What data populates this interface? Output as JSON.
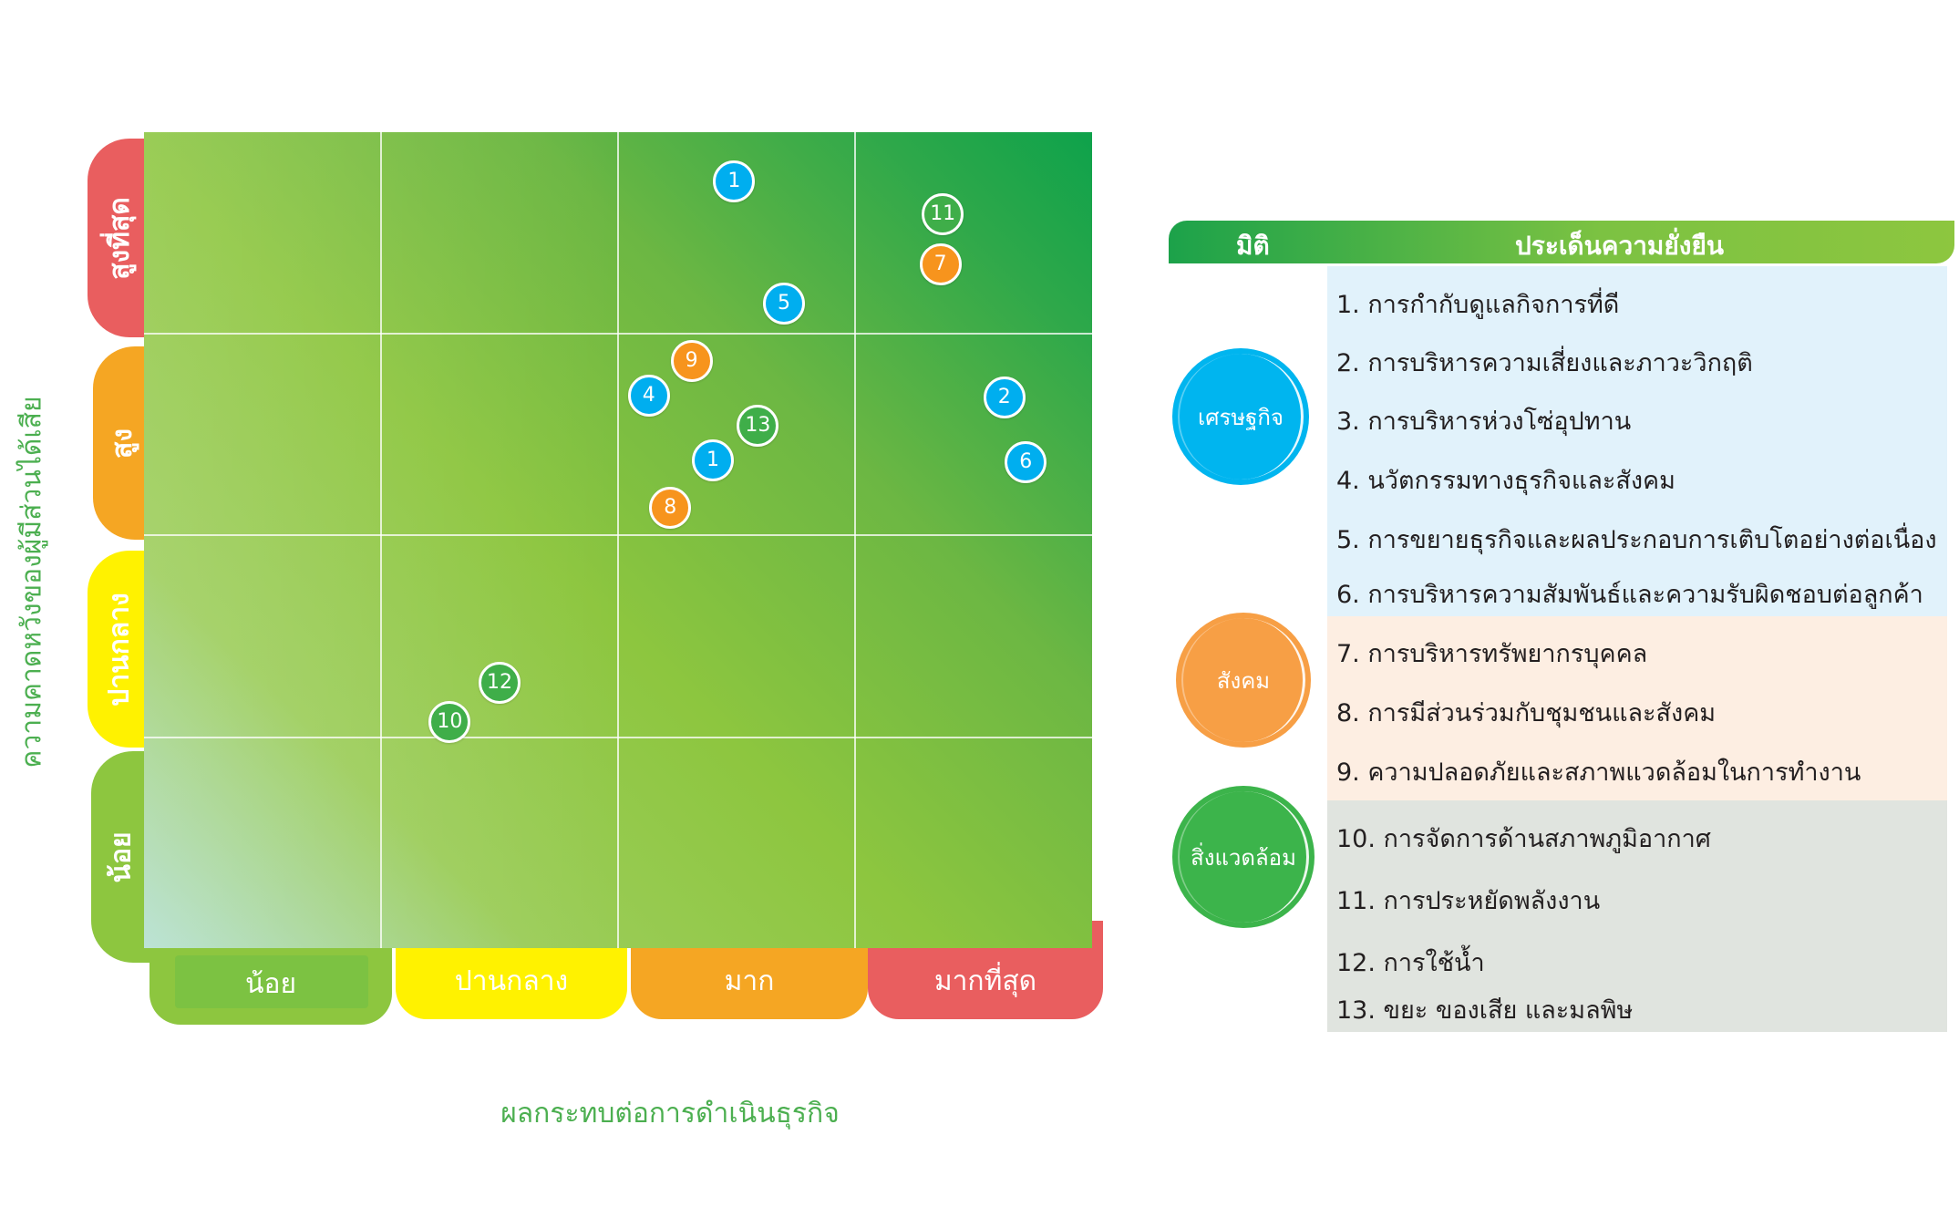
{
  "matrix": {
    "y_levels": [
      "สูงที่สุด",
      "สูง",
      "ปานกลาง",
      "น้อย"
    ],
    "x_levels": [
      "น้อย",
      "ปานกลาง",
      "มาก",
      "มากที่สุด"
    ],
    "y_title": "ความคาดหวังของผู้มีส่วนได้เสีย",
    "x_title": "ผลกระทบต่อการดำเนินธุรกิจ",
    "colors": {
      "level_highest": "#e95e5f",
      "level_high": "#f5a623",
      "level_medium": "#fff200",
      "level_low": "#8dc63f",
      "economic": "#00aeef",
      "social": "#f7941d",
      "environment": "#3fae49"
    }
  },
  "bubbles": [
    {
      "label": "1",
      "dimension": "economic",
      "impact": 2.49,
      "expectation": 3.76
    },
    {
      "label": "5",
      "dimension": "economic",
      "impact": 2.7,
      "expectation": 3.16
    },
    {
      "label": "11",
      "dimension": "environment",
      "impact": 3.37,
      "expectation": 3.6
    },
    {
      "label": "7",
      "dimension": "social",
      "impact": 3.36,
      "expectation": 3.35
    },
    {
      "label": "9",
      "dimension": "social",
      "impact": 2.31,
      "expectation": 2.88
    },
    {
      "label": "4",
      "dimension": "economic",
      "impact": 2.13,
      "expectation": 2.71
    },
    {
      "label": "13",
      "dimension": "environment",
      "impact": 2.59,
      "expectation": 2.56
    },
    {
      "label": "1",
      "dimension": "economic",
      "impact": 2.4,
      "expectation": 2.39
    },
    {
      "label": "8",
      "dimension": "social",
      "impact": 2.22,
      "expectation": 2.16
    },
    {
      "label": "2",
      "dimension": "economic",
      "impact": 3.63,
      "expectation": 2.7
    },
    {
      "label": "6",
      "dimension": "economic",
      "impact": 3.72,
      "expectation": 2.38
    },
    {
      "label": "12",
      "dimension": "environment",
      "impact": 1.5,
      "expectation": 1.3
    },
    {
      "label": "10",
      "dimension": "environment",
      "impact": 1.29,
      "expectation": 1.11
    }
  ],
  "panel": {
    "header_dimension": "มิติ",
    "header_issues": "ประเด็นความยั่งยืน",
    "dimensions": [
      {
        "name": "เศรษฐกิจ",
        "band_color": "#e1f2fb",
        "circle_color": "#00b5ef",
        "issues": [
          "1. การกำกับดูแลกิจการที่ดี",
          "2. การบริหารความเสี่ยงและภาวะวิกฤติ",
          "3. การบริหารห่วงโซ่อุปทาน",
          "4. นวัตกรรมทางธุรกิจและสังคม",
          "5. การขยายธุรกิจและผลประกอบการเติบโตอย่างต่อเนื่อง",
          "6. การบริหารความสัมพันธ์และความรับผิดชอบต่อลูกค้า"
        ]
      },
      {
        "name": "สังคม",
        "band_color": "#fdeee2",
        "circle_color": "#f79f45",
        "issues": [
          "7. การบริหารทรัพยากรบุคคล",
          "8. การมีส่วนร่วมกับชุมชนและสังคม",
          "9. ความปลอดภัยและสภาพแวดล้อมในการทำงาน"
        ]
      },
      {
        "name": "สิ่งแวดล้อม",
        "band_color": "#e0e4df",
        "circle_color": "#3cb44b",
        "issues": [
          "10. การจัดการด้านสภาพภูมิอากาศ",
          "11. การประหยัดพลังงาน",
          "12. การใช้น้ำ",
          "13. ขยะ ของเสีย และมลพิษ"
        ]
      }
    ]
  }
}
